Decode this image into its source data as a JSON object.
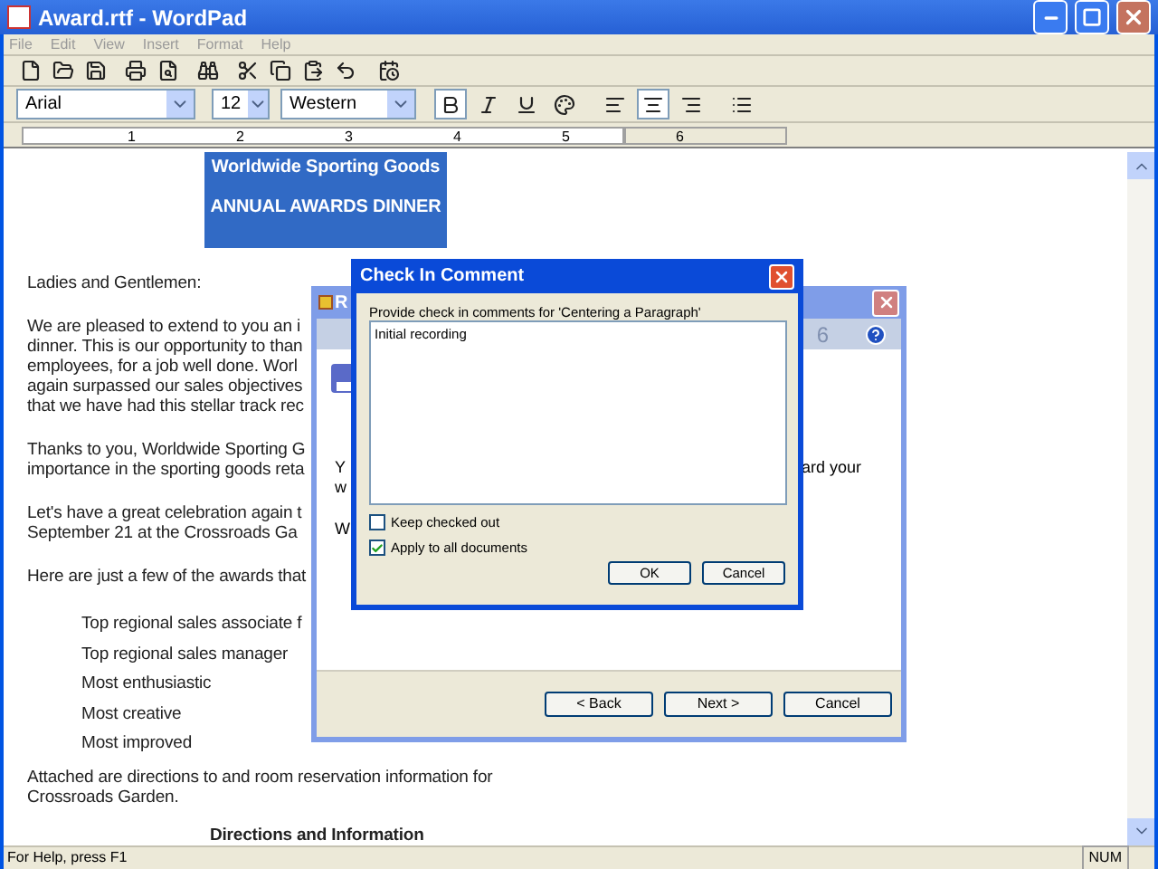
{
  "window": {
    "title": "Award.rtf - WordPad"
  },
  "menu": {
    "disabled": true,
    "items": [
      "File",
      "Edit",
      "View",
      "Insert",
      "Format",
      "Help"
    ]
  },
  "format_bar": {
    "font": "Arial",
    "size": "12",
    "script": "Western",
    "bold": true,
    "align_buttons": [
      {
        "selected": false
      },
      {
        "selected": true
      },
      {
        "selected": false
      }
    ]
  },
  "ruler": {
    "labels": [
      "1",
      "2",
      "3",
      "4",
      "5",
      "6"
    ]
  },
  "document": {
    "heading": [
      "Worldwide Sporting Goods",
      "ANNUAL AWARDS DINNER"
    ],
    "blocks": [
      {
        "kind": "paragraph",
        "lines": [
          "Ladies and Gentlemen:"
        ]
      },
      {
        "kind": "paragraph",
        "lines": [
          "We are pleased to extend to you an i",
          "dinner.  This is our opportunity to than",
          "employees, for a job well done.  Worl",
          "again surpassed our sales objectives",
          "that we have had this stellar track rec"
        ]
      },
      {
        "kind": "paragraph",
        "lines": [
          "Thanks to you, Worldwide Sporting G",
          "importance in the sporting goods reta"
        ]
      },
      {
        "kind": "paragraph",
        "lines": [
          "Let's have a great celebration again t",
          "September 21 at the Crossroads Ga"
        ]
      },
      {
        "kind": "paragraph",
        "lines": [
          "Here are just a few of the awards that"
        ]
      },
      {
        "kind": "list",
        "lines": [
          "Top regional sales associate f",
          "Top regional sales manager",
          "Most enthusiastic",
          "Most creative",
          "Most improved"
        ]
      },
      {
        "kind": "tight",
        "lines": [
          "Attached are directions to and room reservation information for",
          "Crossroads Garden."
        ]
      },
      {
        "kind": "subheading",
        "lines": [
          "Directions and Information"
        ]
      }
    ]
  },
  "status_bar": {
    "help": "For Help, press F1",
    "num": "NUM"
  },
  "wizard": {
    "title": "R",
    "header_fragment": "6",
    "fragments": [
      "Y",
      "ard your",
      "w",
      "W"
    ],
    "buttons": [
      "< Back",
      "Next >",
      "Cancel"
    ]
  },
  "dialog": {
    "title": "Check In Comment",
    "prompt": "Provide check in comments for 'Centering a Paragraph'",
    "comment": "Initial recording",
    "options": [
      {
        "label": "Keep checked out",
        "checked": false
      },
      {
        "label": "Apply to all documents",
        "checked": true
      }
    ],
    "buttons": [
      "OK",
      "Cancel"
    ]
  }
}
